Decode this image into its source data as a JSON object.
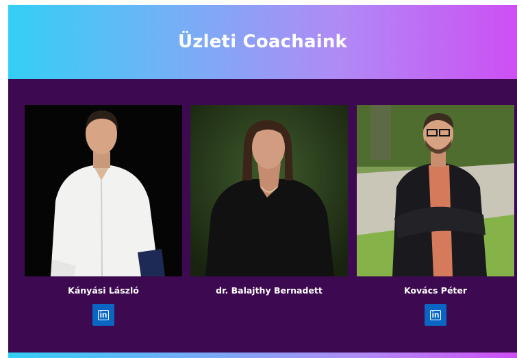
{
  "header": {
    "title": "Üzleti Coachaink"
  },
  "coaches": [
    {
      "name": "Kányási László",
      "linkedin": "in"
    },
    {
      "name": "dr. Balajthy Bernadett"
    },
    {
      "name": "Kovács Péter",
      "linkedin": "in"
    }
  ],
  "colors": {
    "background": "#3d0950",
    "gradient_start": "#33cff5",
    "gradient_end": "#cd4ff4",
    "linkedin_blue": "#0a66c2"
  }
}
